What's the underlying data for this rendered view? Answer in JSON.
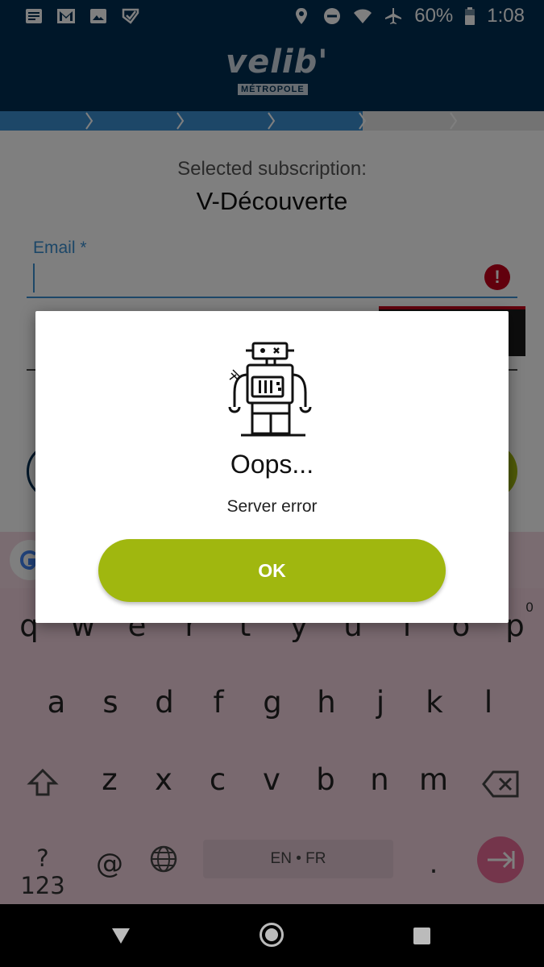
{
  "status_bar": {
    "battery": "60%",
    "time": "1:08"
  },
  "header": {
    "logo_text": "velib'",
    "logo_subtext": "MÉTROPOLE"
  },
  "form": {
    "selected_label": "Selected subscription:",
    "selected_value": "V-Découverte",
    "email_label": "Email *",
    "email_value": "",
    "error_icon_glyph": "!"
  },
  "keyboard": {
    "row1": [
      "q",
      "w",
      "e",
      "r",
      "t",
      "y",
      "u",
      "i",
      "o",
      "p"
    ],
    "row1_hint_p": "0",
    "row2": [
      "a",
      "s",
      "d",
      "f",
      "g",
      "h",
      "j",
      "k",
      "l"
    ],
    "row3": [
      "z",
      "x",
      "c",
      "v",
      "b",
      "n",
      "m"
    ],
    "symbols_key": "?123",
    "at_key": "@",
    "space_label": "EN • FR",
    "period_key": "."
  },
  "dialog": {
    "title": "Oops...",
    "message": "Server error",
    "ok_label": "OK"
  },
  "colors": {
    "brand_navy": "#002e52",
    "accent_green": "#a0b70f",
    "error_red": "#c4001a",
    "progress_blue": "#3a8fd0"
  }
}
